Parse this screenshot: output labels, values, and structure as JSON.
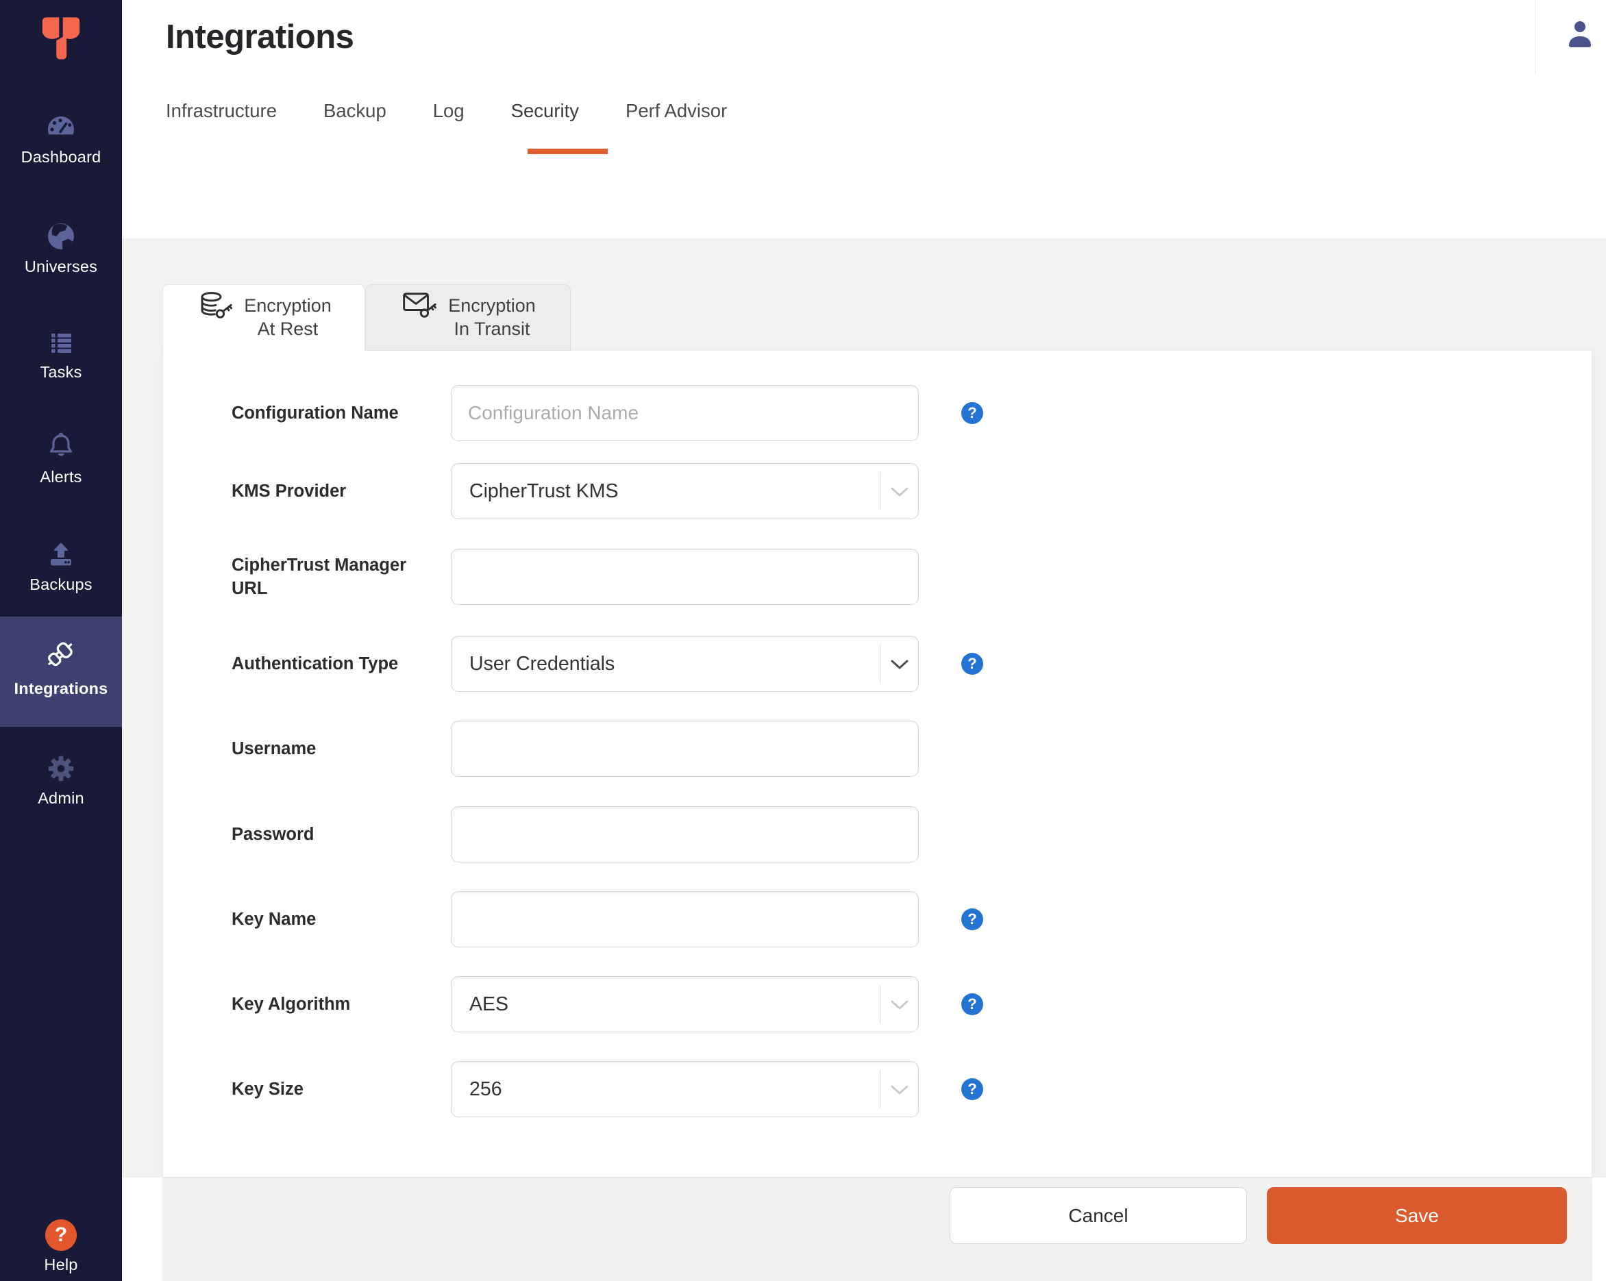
{
  "sidebar": {
    "items": [
      {
        "label": "Dashboard"
      },
      {
        "label": "Universes"
      },
      {
        "label": "Tasks"
      },
      {
        "label": "Alerts"
      },
      {
        "label": "Backups"
      },
      {
        "label": "Integrations",
        "active": true
      },
      {
        "label": "Admin"
      }
    ],
    "help_label": "Help"
  },
  "header": {
    "title": "Integrations",
    "tabs": [
      {
        "label": "Infrastructure"
      },
      {
        "label": "Backup"
      },
      {
        "label": "Log"
      },
      {
        "label": "Security",
        "active": true
      },
      {
        "label": "Perf Advisor"
      }
    ]
  },
  "encryption_tabs": [
    {
      "line1": "Encryption",
      "line2": "At Rest",
      "active": true
    },
    {
      "line1": "Encryption",
      "line2": "In Transit",
      "active": false
    }
  ],
  "form": {
    "rows": [
      {
        "label": "Configuration Name",
        "type": "input",
        "placeholder": "Configuration Name",
        "help": true
      },
      {
        "label": "KMS Provider",
        "type": "select",
        "value": "CipherTrust KMS",
        "help": false
      },
      {
        "label": "CipherTrust Manager URL",
        "type": "input",
        "placeholder": "",
        "help": false
      },
      {
        "label": "Authentication Type",
        "type": "select",
        "value": "User Credentials",
        "help": true
      },
      {
        "label": "Username",
        "type": "input",
        "placeholder": "",
        "help": false
      },
      {
        "label": "Password",
        "type": "input",
        "placeholder": "",
        "help": false
      },
      {
        "label": "Key Name",
        "type": "input",
        "placeholder": "",
        "help": true
      },
      {
        "label": "Key Algorithm",
        "type": "select",
        "value": "AES",
        "help": true
      },
      {
        "label": "Key Size",
        "type": "select",
        "value": "256",
        "help": true
      }
    ]
  },
  "footer": {
    "cancel_label": "Cancel",
    "save_label": "Save"
  },
  "icons": {
    "question_glyph": "?"
  },
  "colors": {
    "sidebar_bg": "#181A38",
    "sidebar_active_bg": "#3C4170",
    "sidebar_icon": "#5C6499",
    "logo_orange": "#F4674C",
    "accent_orange": "#DB5A2D",
    "tab_underline_orange": "#DD5F31",
    "help_blue": "#2474D4",
    "page_gray": "#F2F2F1"
  }
}
